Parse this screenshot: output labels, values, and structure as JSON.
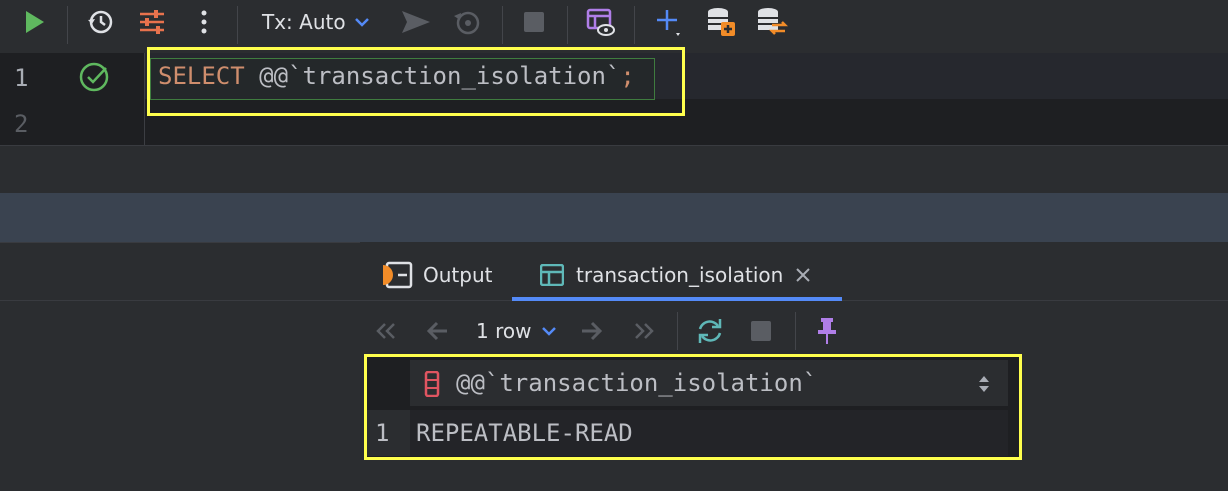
{
  "toolbar": {
    "tx_label": "Tx: Auto",
    "icons": [
      "run-icon",
      "history-icon",
      "settings-icon",
      "more-icon",
      "chevron-down-icon",
      "submit-icon",
      "rollback-icon",
      "stop-icon",
      "explain-plan-icon",
      "add-icon",
      "datasource-add-icon",
      "datasource-switch-icon"
    ]
  },
  "editor": {
    "lines": [
      "1",
      "2"
    ],
    "code": {
      "keyword": "SELECT",
      "expr": "@@`transaction_isolation`",
      "terminator": ";"
    }
  },
  "results": {
    "tabs": [
      {
        "label": "Output"
      },
      {
        "label": "transaction_isolation"
      }
    ],
    "row_count": "1 row",
    "grid": {
      "column": "@@`transaction_isolation`",
      "rows": [
        {
          "num": "1",
          "value": "REPEATABLE-READ"
        }
      ]
    }
  },
  "colors": {
    "highlight": "#ffff4d",
    "accent": "#548af7",
    "keyword": "#cf8e6d",
    "run": "#5fb85f"
  }
}
